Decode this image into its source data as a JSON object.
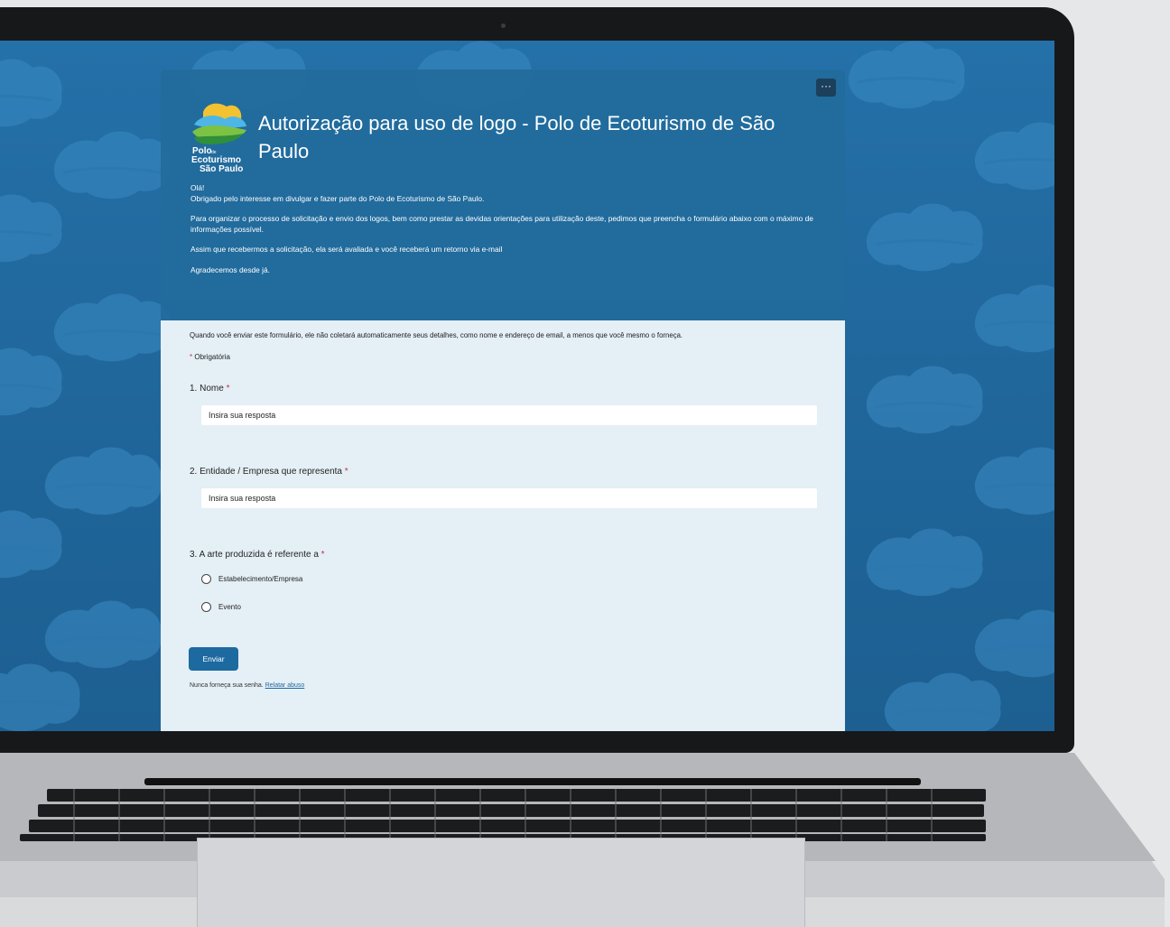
{
  "form": {
    "title": "Autorização para uso de logo - Polo de Ecoturismo de São Paulo",
    "more_label": "···",
    "logo": {
      "line1": "Polo",
      "line2": "Ecoturismo",
      "line3": "São Paulo",
      "small": "de"
    },
    "description": [
      "Olá!\nObrigado pelo interesse em divulgar e fazer parte do Polo de Ecoturismo de São Paulo.",
      "Para organizar o processo de solicitação e envio dos logos, bem como prestar as devidas orientações para utilização deste, pedimos que preencha o formulário abaixo com o máximo de informações possível.",
      "Assim que recebermos a solicitação, ela será avaliada e você receberá um retorno via e-mail",
      "Agradecemos desde já."
    ],
    "notice": "Quando você enviar este formulário, ele não coletará automaticamente seus detalhes, como nome e endereço de email, a menos que você mesmo o forneça.",
    "required_note": "Obrigatória",
    "required_mark": "*",
    "questions": [
      {
        "label": "1. Nome",
        "placeholder": "Insira sua resposta"
      },
      {
        "label": "2. Entidade / Empresa que representa",
        "placeholder": "Insira sua resposta"
      },
      {
        "label": "3. A arte produzida é referente a",
        "options": [
          "Estabelecimento/Empresa",
          "Evento"
        ]
      }
    ],
    "submit_label": "Enviar",
    "footer_text": "Nunca forneça sua senha.",
    "report_link": "Relatar abuso"
  },
  "colors": {
    "background": "#1f6599",
    "header": "#226b9c",
    "body": "#e4eff6",
    "accent": "#1d6aa0",
    "required": "#c4314b"
  }
}
